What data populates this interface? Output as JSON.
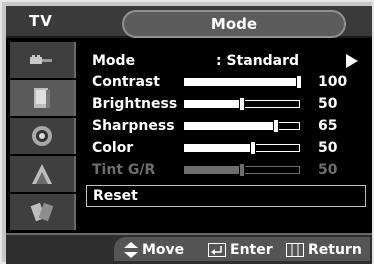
{
  "header": {
    "tv_label": "TV",
    "title": "Mode"
  },
  "sidebar": {
    "items": [
      {
        "icon": "input-plug-icon"
      },
      {
        "icon": "picture-icon"
      },
      {
        "icon": "sound-icon"
      },
      {
        "icon": "channel-icon"
      },
      {
        "icon": "setup-icon"
      }
    ]
  },
  "menu": {
    "mode": {
      "label": "Mode",
      "value": ": Standard"
    },
    "sliders": [
      {
        "label": "Contrast",
        "value": 100,
        "value_text": "100",
        "level_percent": 100,
        "enabled": true
      },
      {
        "label": "Brightness",
        "value": 50,
        "value_text": "50",
        "level_percent": 50,
        "enabled": true
      },
      {
        "label": "Sharpness",
        "value": 65,
        "value_text": "65",
        "level_percent": 80,
        "enabled": true
      },
      {
        "label": "Color",
        "value": 50,
        "value_text": "50",
        "level_percent": 60,
        "enabled": true
      },
      {
        "label": "Tint G/R",
        "value": 50,
        "value_text": "50",
        "level_percent": 50,
        "enabled": false
      }
    ],
    "reset_label": "Reset"
  },
  "footer": {
    "move_label": "Move",
    "enter_label": "Enter",
    "return_label": "Return"
  }
}
